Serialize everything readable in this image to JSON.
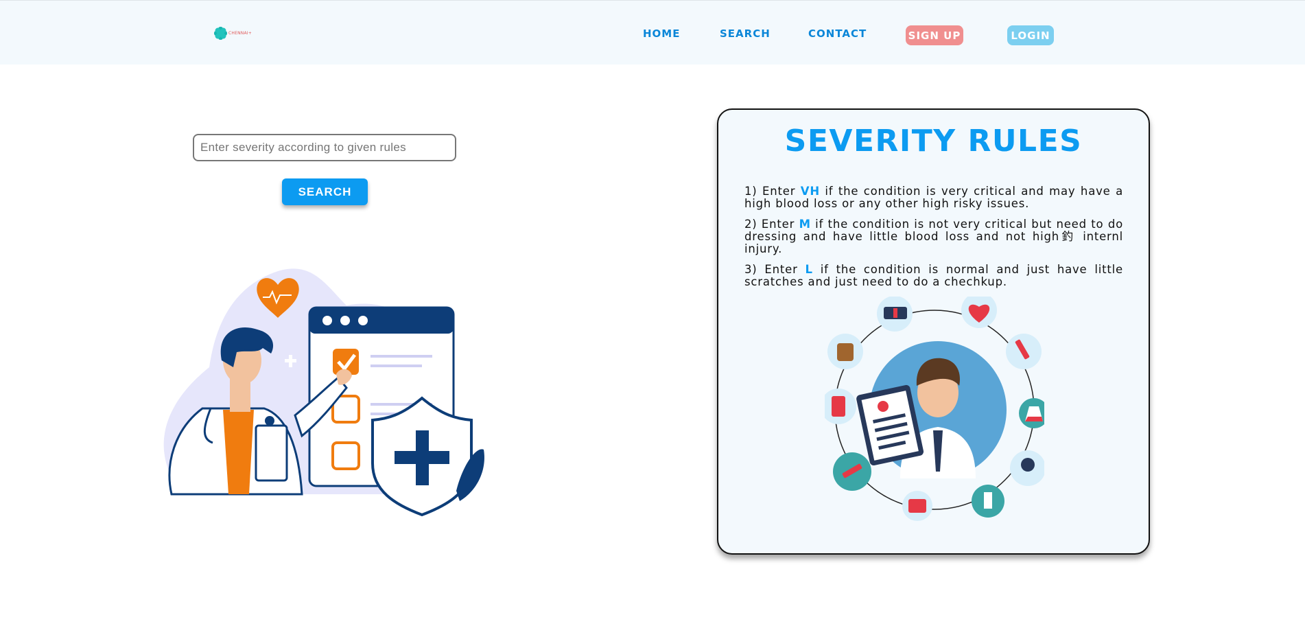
{
  "brand": {
    "logo_text": "CHENNAI+"
  },
  "nav": {
    "home": "HOME",
    "search": "SEARCH",
    "contact": "CONTACT",
    "signup": "SIGN UP",
    "login": "LOGIN"
  },
  "search": {
    "placeholder": "Enter severity according to given rules",
    "button_label": "SEARCH"
  },
  "rules": {
    "title": "SEVERITY RULES",
    "items": [
      {
        "prefix": "1) Enter ",
        "code": "VH",
        "text": " if the condition is very critical and may have a high blood loss or any other high risky issues."
      },
      {
        "prefix": "2) Enter ",
        "code": "M",
        "text": " if the condition is not very critical but need to do dressing and have little blood loss and not high釣 internl injury."
      },
      {
        "prefix": "3) Enter ",
        "code": "L",
        "text": " if the condition is normal and just have little scratches and just need to do a chechkup."
      }
    ]
  },
  "colors": {
    "accent": "#0c9bf1",
    "nav_text": "#0a86d8",
    "signup_bg": "#f08f8f",
    "login_bg": "#7ccff0",
    "navbar_bg": "#f3f9fd"
  }
}
